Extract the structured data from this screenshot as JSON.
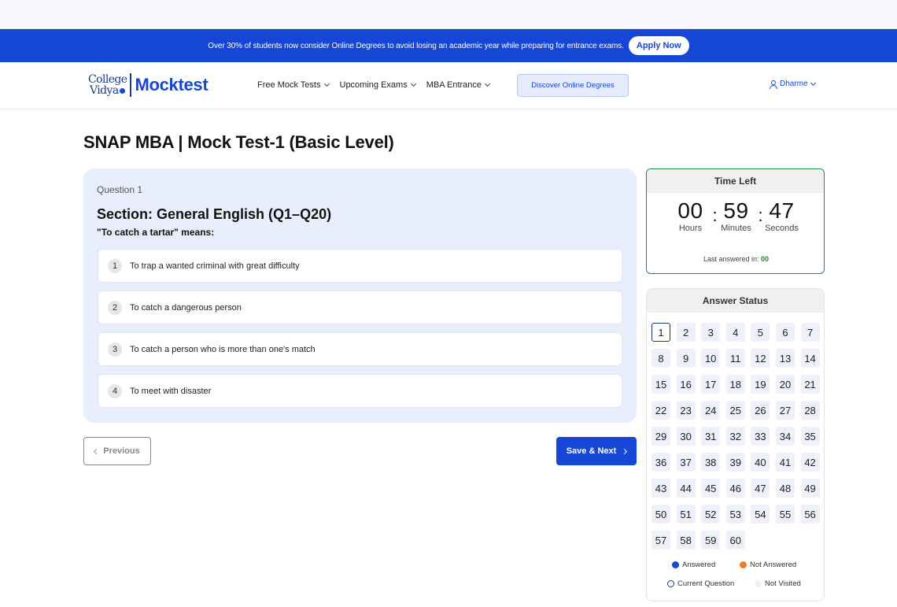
{
  "promo": {
    "text": "Over 30% of students now consider Online Degrees to avoid losing an academic year while preparing for entrance exams.",
    "button_label": "Apply Now"
  },
  "nav": {
    "logo_college": "College",
    "logo_vidya": "Vidya",
    "logo_mocktest": "Mocktest",
    "menu": [
      {
        "label": "Free Mock Tests"
      },
      {
        "label": "Upcoming Exams"
      },
      {
        "label": "MBA Entrance"
      }
    ],
    "discover_label": "Discover Online Degrees",
    "user_name": "Dharme"
  },
  "page_title": "SNAP MBA | Mock Test-1 (Basic Level)",
  "question": {
    "number_label": "Question 1",
    "section": "Section: General English (Q1–Q20)",
    "text": "\"To catch a tartar\" means:",
    "options": [
      {
        "num": "1",
        "text": "To trap a wanted criminal with great difficulty"
      },
      {
        "num": "2",
        "text": "To catch a dangerous person"
      },
      {
        "num": "3",
        "text": "To catch a person who is more than one's match"
      },
      {
        "num": "4",
        "text": "To meet with disaster"
      }
    ]
  },
  "buttons": {
    "previous": "Previous",
    "save_next": "Save & Next"
  },
  "timer": {
    "title": "Time Left",
    "hours": "00",
    "minutes": "59",
    "seconds": "47",
    "sep": ":",
    "hours_label": "Hours",
    "minutes_label": "Minutes",
    "seconds_label": "Seconds",
    "last_answered_label": "Last answered in:",
    "last_answered_value": "00"
  },
  "answer_status": {
    "title": "Answer Status",
    "questions": [
      "1",
      "2",
      "3",
      "4",
      "5",
      "6",
      "7",
      "8",
      "9",
      "10",
      "11",
      "12",
      "13",
      "14",
      "15",
      "16",
      "17",
      "18",
      "19",
      "20",
      "21",
      "22",
      "23",
      "24",
      "25",
      "26",
      "27",
      "28",
      "29",
      "30",
      "31",
      "32",
      "33",
      "34",
      "35",
      "36",
      "37",
      "38",
      "39",
      "40",
      "41",
      "42",
      "43",
      "44",
      "45",
      "46",
      "47",
      "48",
      "49",
      "50",
      "51",
      "52",
      "53",
      "54",
      "55",
      "56",
      "57",
      "58",
      "59",
      "60"
    ],
    "current": "1",
    "legend": {
      "answered": "Answered",
      "not_answered": "Not Answered",
      "current_question": "Current Question",
      "not_visited": "Not Visited"
    }
  },
  "colors": {
    "primary": "#1546d6",
    "timer_border": "#1f8a3d",
    "answered": "#1546d6",
    "not_answered": "#f07c1a",
    "not_visited": "#eef1fa"
  }
}
